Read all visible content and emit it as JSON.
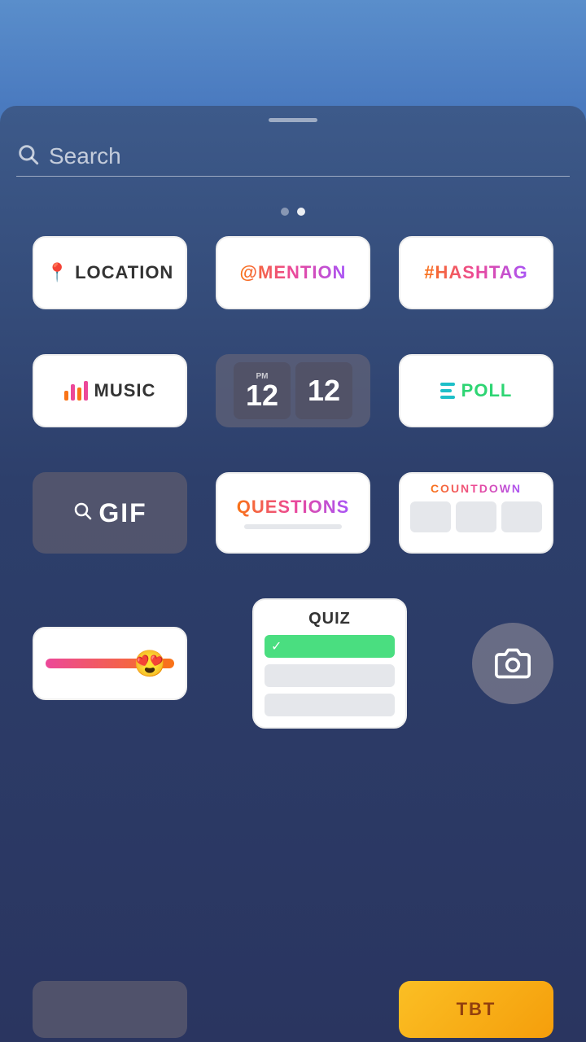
{
  "colors": {
    "bg_top": "#5a8ecb",
    "sheet_bg": "#3d5a8a",
    "accent": "#ec4899"
  },
  "search": {
    "placeholder": "Search"
  },
  "dots": {
    "inactive": "•",
    "active": "•"
  },
  "stickers": {
    "row1": [
      {
        "id": "location",
        "label": "LOCATION"
      },
      {
        "id": "mention",
        "label": "@MENTION"
      },
      {
        "id": "hashtag",
        "label": "#HASHTAG"
      }
    ],
    "row2": [
      {
        "id": "music",
        "label": "MUSIC"
      },
      {
        "id": "time",
        "label": "12 12"
      },
      {
        "id": "poll",
        "label": "POLL"
      }
    ],
    "row3": [
      {
        "id": "gif",
        "label": "GIF"
      },
      {
        "id": "questions",
        "label": "QUESTIONS"
      },
      {
        "id": "countdown",
        "label": "COUNTDOWN"
      }
    ],
    "row4": [
      {
        "id": "emoji-slider",
        "label": ""
      },
      {
        "id": "quiz",
        "label": "QUIZ"
      },
      {
        "id": "camera",
        "label": ""
      }
    ]
  }
}
